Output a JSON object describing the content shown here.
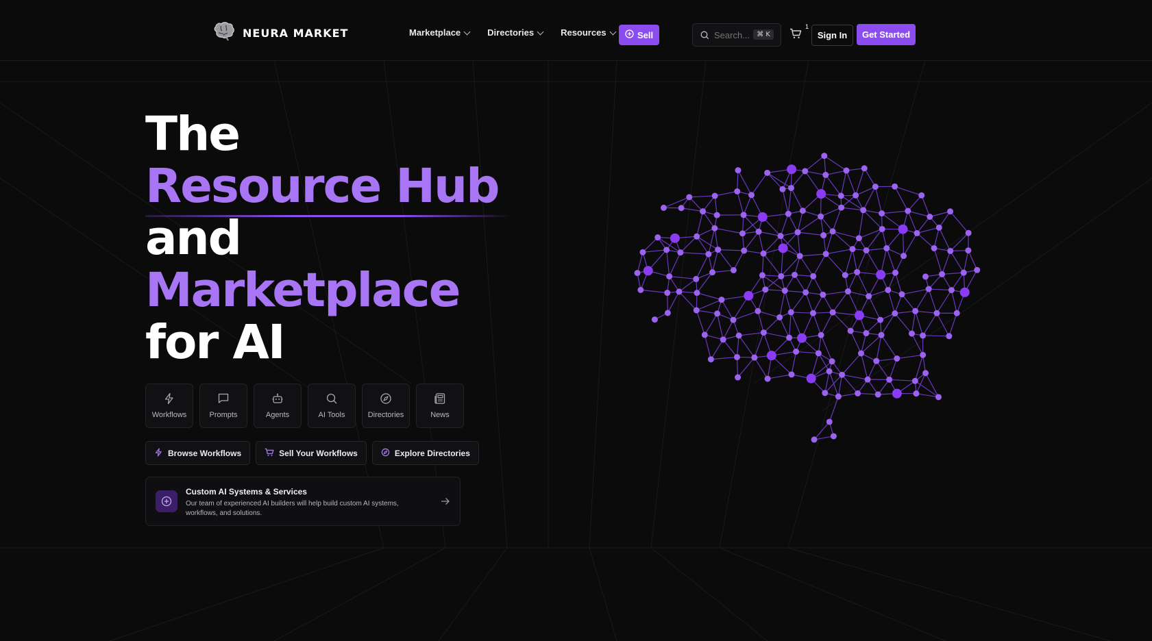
{
  "brand": {
    "name": "NEURA MARKET",
    "logo_icon": "brain-icon"
  },
  "nav": {
    "items": [
      {
        "label": "Marketplace"
      },
      {
        "label": "Directories"
      },
      {
        "label": "Resources"
      }
    ],
    "sell_label": "Sell",
    "search_placeholder": "Search...",
    "search_shortcut": "⌘ K",
    "cart_count": "1",
    "signin_label": "Sign In",
    "get_started_label": "Get Started"
  },
  "hero": {
    "line1": "The",
    "line2": "Resource Hub",
    "line3": "and",
    "line4": "Marketplace",
    "line5": "for AI"
  },
  "categories": [
    {
      "label": "Workflows",
      "icon": "lightning-icon"
    },
    {
      "label": "Prompts",
      "icon": "chat-icon"
    },
    {
      "label": "Agents",
      "icon": "robot-icon"
    },
    {
      "label": "AI Tools",
      "icon": "search-icon"
    },
    {
      "label": "Directories",
      "icon": "compass-icon"
    },
    {
      "label": "News",
      "icon": "newspaper-icon"
    }
  ],
  "actions": [
    {
      "label": "Browse Workflows",
      "icon": "lightning-icon"
    },
    {
      "label": "Sell Your Workflows",
      "icon": "cart-icon"
    },
    {
      "label": "Explore Directories",
      "icon": "compass-icon"
    }
  ],
  "service_card": {
    "title": "Custom AI Systems & Services",
    "description": "Our team of experienced AI builders will help build custom AI systems, workflows, and solutions."
  },
  "colors": {
    "accent": "#8b4df0",
    "accent_light": "#a876f5",
    "background": "#0b0b0c"
  }
}
